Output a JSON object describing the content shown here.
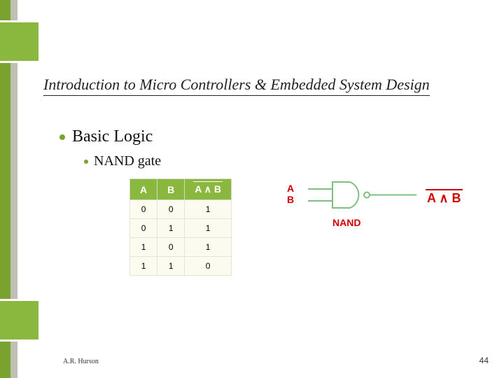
{
  "title": "Introduction to Micro Controllers & Embedded System Design",
  "bullet_l1": "Basic Logic",
  "bullet_l2": "NAND gate",
  "table": {
    "headers": {
      "a": "A",
      "b": "B",
      "out": "A ∧ B"
    },
    "rows": [
      {
        "a": "0",
        "b": "0",
        "out": "1"
      },
      {
        "a": "0",
        "b": "1",
        "out": "1"
      },
      {
        "a": "1",
        "b": "0",
        "out": "1"
      },
      {
        "a": "1",
        "b": "1",
        "out": "0"
      }
    ]
  },
  "gate": {
    "in_a": "A",
    "in_b": "B",
    "name": "NAND",
    "output": "A ∧ B"
  },
  "author": "A.R. Hurson",
  "page": "44"
}
